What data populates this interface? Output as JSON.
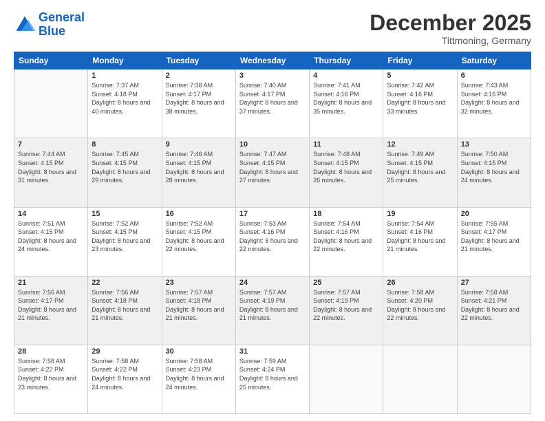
{
  "logo": {
    "line1": "General",
    "line2": "Blue"
  },
  "title": "December 2025",
  "subtitle": "Tittmoning, Germany",
  "days_header": [
    "Sunday",
    "Monday",
    "Tuesday",
    "Wednesday",
    "Thursday",
    "Friday",
    "Saturday"
  ],
  "weeks": [
    [
      {
        "day": "",
        "empty": true
      },
      {
        "day": "1",
        "sunrise": "7:37 AM",
        "sunset": "4:18 PM",
        "daylight": "8 hours and 40 minutes."
      },
      {
        "day": "2",
        "sunrise": "7:38 AM",
        "sunset": "4:17 PM",
        "daylight": "8 hours and 38 minutes."
      },
      {
        "day": "3",
        "sunrise": "7:40 AM",
        "sunset": "4:17 PM",
        "daylight": "8 hours and 37 minutes."
      },
      {
        "day": "4",
        "sunrise": "7:41 AM",
        "sunset": "4:16 PM",
        "daylight": "8 hours and 35 minutes."
      },
      {
        "day": "5",
        "sunrise": "7:42 AM",
        "sunset": "4:16 PM",
        "daylight": "8 hours and 33 minutes."
      },
      {
        "day": "6",
        "sunrise": "7:43 AM",
        "sunset": "4:16 PM",
        "daylight": "8 hours and 32 minutes."
      }
    ],
    [
      {
        "day": "7",
        "sunrise": "7:44 AM",
        "sunset": "4:15 PM",
        "daylight": "8 hours and 31 minutes."
      },
      {
        "day": "8",
        "sunrise": "7:45 AM",
        "sunset": "4:15 PM",
        "daylight": "8 hours and 29 minutes."
      },
      {
        "day": "9",
        "sunrise": "7:46 AM",
        "sunset": "4:15 PM",
        "daylight": "8 hours and 28 minutes."
      },
      {
        "day": "10",
        "sunrise": "7:47 AM",
        "sunset": "4:15 PM",
        "daylight": "8 hours and 27 minutes."
      },
      {
        "day": "11",
        "sunrise": "7:48 AM",
        "sunset": "4:15 PM",
        "daylight": "8 hours and 26 minutes."
      },
      {
        "day": "12",
        "sunrise": "7:49 AM",
        "sunset": "4:15 PM",
        "daylight": "8 hours and 25 minutes."
      },
      {
        "day": "13",
        "sunrise": "7:50 AM",
        "sunset": "4:15 PM",
        "daylight": "8 hours and 24 minutes."
      }
    ],
    [
      {
        "day": "14",
        "sunrise": "7:51 AM",
        "sunset": "4:15 PM",
        "daylight": "8 hours and 24 minutes."
      },
      {
        "day": "15",
        "sunrise": "7:52 AM",
        "sunset": "4:15 PM",
        "daylight": "8 hours and 23 minutes."
      },
      {
        "day": "16",
        "sunrise": "7:52 AM",
        "sunset": "4:15 PM",
        "daylight": "8 hours and 22 minutes."
      },
      {
        "day": "17",
        "sunrise": "7:53 AM",
        "sunset": "4:16 PM",
        "daylight": "8 hours and 22 minutes."
      },
      {
        "day": "18",
        "sunrise": "7:54 AM",
        "sunset": "4:16 PM",
        "daylight": "8 hours and 22 minutes."
      },
      {
        "day": "19",
        "sunrise": "7:54 AM",
        "sunset": "4:16 PM",
        "daylight": "8 hours and 21 minutes."
      },
      {
        "day": "20",
        "sunrise": "7:55 AM",
        "sunset": "4:17 PM",
        "daylight": "8 hours and 21 minutes."
      }
    ],
    [
      {
        "day": "21",
        "sunrise": "7:56 AM",
        "sunset": "4:17 PM",
        "daylight": "8 hours and 21 minutes."
      },
      {
        "day": "22",
        "sunrise": "7:56 AM",
        "sunset": "4:18 PM",
        "daylight": "8 hours and 21 minutes."
      },
      {
        "day": "23",
        "sunrise": "7:57 AM",
        "sunset": "4:18 PM",
        "daylight": "8 hours and 21 minutes."
      },
      {
        "day": "24",
        "sunrise": "7:57 AM",
        "sunset": "4:19 PM",
        "daylight": "8 hours and 21 minutes."
      },
      {
        "day": "25",
        "sunrise": "7:57 AM",
        "sunset": "4:19 PM",
        "daylight": "8 hours and 22 minutes."
      },
      {
        "day": "26",
        "sunrise": "7:58 AM",
        "sunset": "4:20 PM",
        "daylight": "8 hours and 22 minutes."
      },
      {
        "day": "27",
        "sunrise": "7:58 AM",
        "sunset": "4:21 PM",
        "daylight": "8 hours and 22 minutes."
      }
    ],
    [
      {
        "day": "28",
        "sunrise": "7:58 AM",
        "sunset": "4:22 PM",
        "daylight": "8 hours and 23 minutes."
      },
      {
        "day": "29",
        "sunrise": "7:58 AM",
        "sunset": "4:22 PM",
        "daylight": "8 hours and 24 minutes."
      },
      {
        "day": "30",
        "sunrise": "7:58 AM",
        "sunset": "4:23 PM",
        "daylight": "8 hours and 24 minutes."
      },
      {
        "day": "31",
        "sunrise": "7:59 AM",
        "sunset": "4:24 PM",
        "daylight": "8 hours and 25 minutes."
      },
      {
        "day": "",
        "empty": true
      },
      {
        "day": "",
        "empty": true
      },
      {
        "day": "",
        "empty": true
      }
    ]
  ]
}
